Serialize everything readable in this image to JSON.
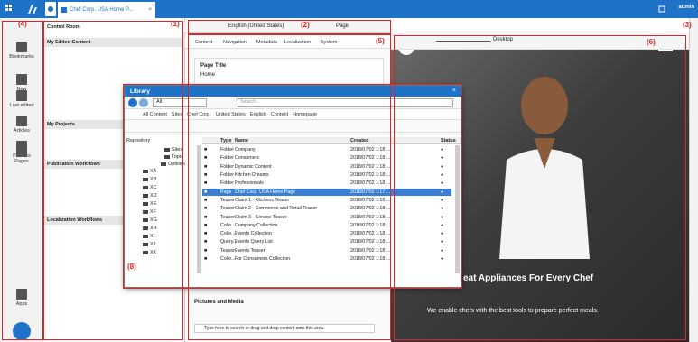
{
  "topbar": {
    "tab_title": "Chef Corp. USA Home P...",
    "user": "admin"
  },
  "leftbar": {
    "items": [
      {
        "label": "Bookmarks",
        "icon": "bookmarks-icon"
      },
      {
        "label": "New",
        "icon": "new-document-icon"
      },
      {
        "label": "Last edited",
        "icon": "last-edited-icon"
      },
      {
        "label": "Articles",
        "icon": "articles-icon"
      },
      {
        "label": "Pictures",
        "icon": "pictures-icon"
      },
      {
        "label": "Pages",
        "icon": "pages-icon"
      },
      {
        "label": "Apps",
        "icon": "apps-icon"
      }
    ]
  },
  "control_room": {
    "title": "Control Room",
    "sections": [
      "My Edited Content",
      "My Projects",
      "Publication Workflows",
      "Localization Workflows"
    ]
  },
  "editor": {
    "locale": "English (United States)",
    "page_label": "Page",
    "tabs": [
      "Content",
      "Navigation",
      "Metadata",
      "Localization",
      "System"
    ],
    "page_title_label": "Page Title",
    "page_title_value": "Home",
    "pictures_label": "Pictures and Media",
    "drop_placeholder": "Type here to search or drag and drop content onto this area."
  },
  "preview": {
    "device": "Desktop",
    "hero_title": "eat Appliances For Every Chef",
    "hero_subtitle": "We enable chefs with the best tools to prepare perfect meals."
  },
  "annotations": [
    "(1)",
    "(2)",
    "(3)",
    "(4)",
    "(5)",
    "(6)",
    "(8)"
  ],
  "library": {
    "title": "Library",
    "search_placeholder": "Search...",
    "scope": "All",
    "breadcrumb": [
      "All Content",
      "Sites",
      "Chef Corp.",
      "United States",
      "English",
      "Content",
      "Homepage"
    ],
    "repository_label": "Repository",
    "tree": [
      "Sites",
      "Topic",
      "Options",
      "XA",
      "XB",
      "XC",
      "XD",
      "XE",
      "XF",
      "XG",
      "XH",
      "XI",
      "XJ",
      "XK"
    ],
    "columns": [
      "Type",
      "Name",
      "Created",
      "Status"
    ],
    "rows": [
      {
        "type": "Folder",
        "name": "Company",
        "created": "2018/07/02 1:18 ...",
        "selected": false
      },
      {
        "type": "Folder",
        "name": "Consumers",
        "created": "2018/07/02 1:18 ...",
        "selected": false
      },
      {
        "type": "Folder",
        "name": "Dynamic Content",
        "created": "2018/07/02 1:18 ...",
        "selected": false
      },
      {
        "type": "Folder",
        "name": "Kitchen Dreams",
        "created": "2018/07/02 1:18 ...",
        "selected": false
      },
      {
        "type": "Folder",
        "name": "Professionals",
        "created": "2018/07/02 1:18 ...",
        "selected": false
      },
      {
        "type": "Page",
        "name": "Chef Corp. USA Home Page",
        "created": "2018/07/02 1:17 ...",
        "selected": true
      },
      {
        "type": "Teaser",
        "name": "Claim 1 - Kitchens Teaser",
        "created": "2018/07/02 1:18 ...",
        "selected": false
      },
      {
        "type": "Teaser",
        "name": "Claim 2 - Commerce and Retail Teaser",
        "created": "2018/07/02 1:18 ...",
        "selected": false
      },
      {
        "type": "Teaser",
        "name": "Claim 3 - Service Teaser",
        "created": "2018/07/02 1:18 ...",
        "selected": false
      },
      {
        "type": "Colle...",
        "name": "Company Collection",
        "created": "2018/07/02 1:18 ...",
        "selected": false
      },
      {
        "type": "Colle...",
        "name": "Events Collection",
        "created": "2018/07/02 1:18 ...",
        "selected": false
      },
      {
        "type": "Query...",
        "name": "Events Query List",
        "created": "2018/07/02 1:18 ...",
        "selected": false
      },
      {
        "type": "Teaser",
        "name": "Events Teaser",
        "created": "2018/07/02 1:18 ...",
        "selected": false
      },
      {
        "type": "Colle...",
        "name": "For Consumers Collection",
        "created": "2018/07/02 1:18 ...",
        "selected": false
      }
    ]
  },
  "colors": {
    "accent": "#1e72c8",
    "annotation": "#d62828",
    "selected": "#3a7fd5"
  }
}
